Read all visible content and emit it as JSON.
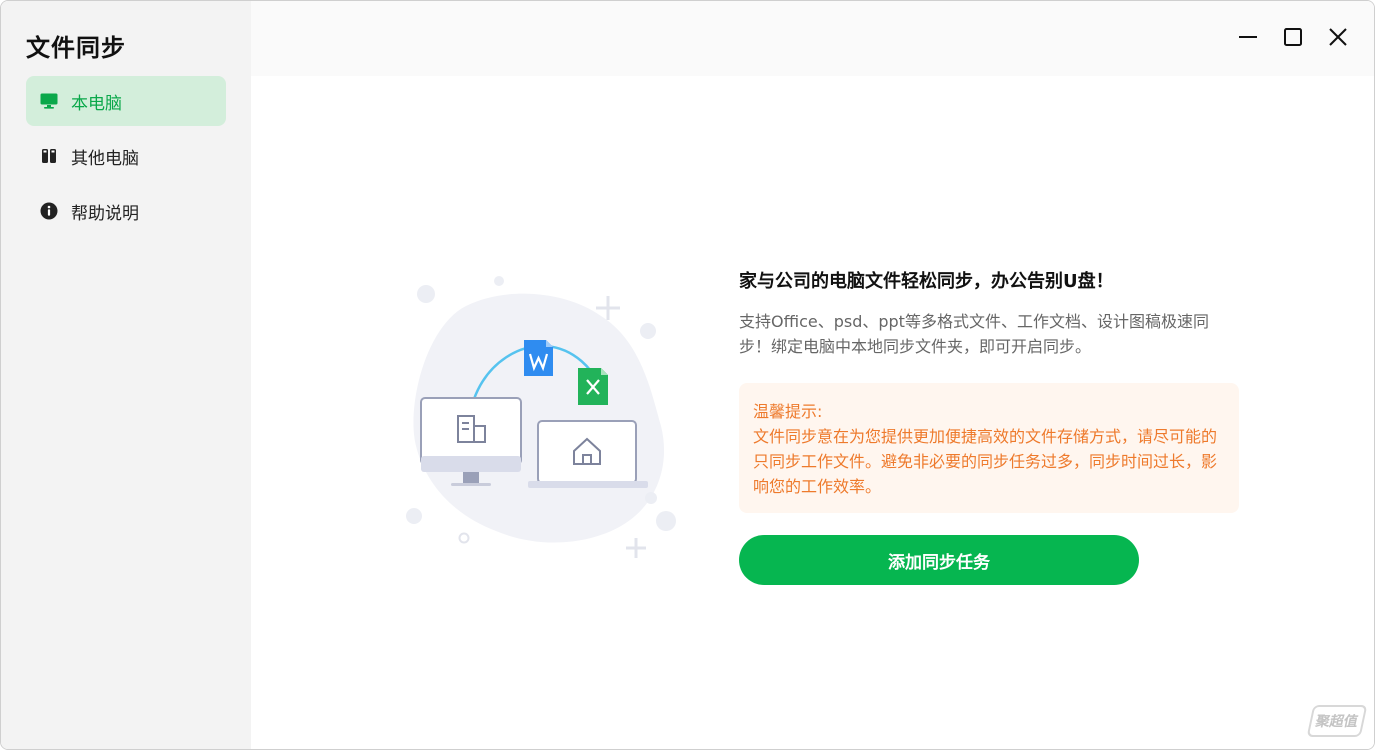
{
  "sidebar": {
    "title": "文件同步",
    "items": [
      {
        "label": "本电脑",
        "icon": "monitor-icon",
        "active": true
      },
      {
        "label": "其他电脑",
        "icon": "devices-icon",
        "active": false
      },
      {
        "label": "帮助说明",
        "icon": "info-icon",
        "active": false
      }
    ]
  },
  "window_controls": {
    "minimize": "minimize-icon",
    "maximize": "maximize-icon",
    "close": "close-icon"
  },
  "main": {
    "headline": "家与公司的电脑文件轻松同步，办公告别U盘！",
    "description": "支持Office、psd、ppt等多格式文件、工作文档、设计图稿极速同步！绑定电脑中本地同步文件夹，即可开启同步。",
    "tip_title": "温馨提示:",
    "tip_body": "文件同步意在为您提供更加便捷高效的文件存储方式，请尽可能的只同步工作文件。避免非必要的同步任务过多，同步时间过长，影响您的工作效率。",
    "add_button_label": "添加同步任务"
  },
  "colors": {
    "accent": "#06b650",
    "active_bg": "#d3eedb",
    "tip_text": "#ee7a2c",
    "tip_bg": "#fff6ef"
  },
  "watermark": "聚超值"
}
